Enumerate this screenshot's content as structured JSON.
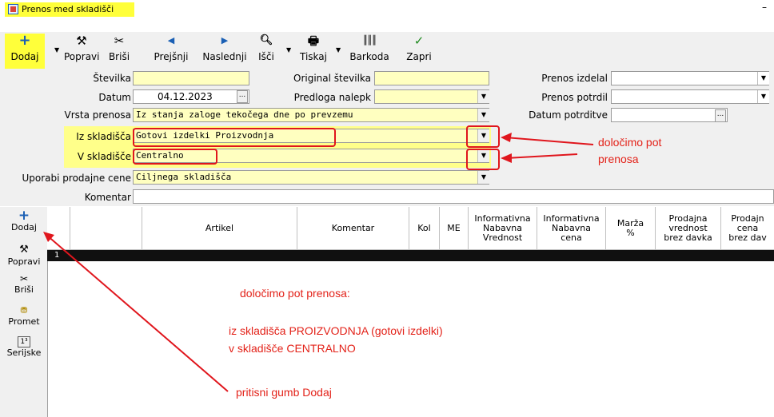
{
  "window": {
    "title": "Prenos med skladišči",
    "minimize": "–"
  },
  "toolbar": {
    "add": "Dodaj",
    "edit": "Popravi",
    "delete": "Briši",
    "previous": "Prejšnji",
    "next": "Naslednji",
    "search": "Išči",
    "print": "Tiskaj",
    "barcode": "Barkoda",
    "close": "Zapri"
  },
  "form": {
    "stevilka_label": "Številka",
    "datum_label": "Datum",
    "datum_value": "04.12.2023",
    "vrsta_label": "Vrsta prenosa",
    "vrsta_value": "Iz stanja zaloge tekočega dne po prevzemu",
    "original_label": "Original številka",
    "predloga_label": "Predloga nalepk",
    "iz_label": "Iz skladišča",
    "iz_value": "Gotovi izdelki      Proizvodnja",
    "v_label": "V skladišče",
    "v_value": "Centralno",
    "uporabi_label": "Uporabi prodajne cene",
    "uporabi_value": "Ciljnega skladišča",
    "komentar_label": "Komentar",
    "izdelal_label": "Prenos izdelal",
    "potrdil_label": "Prenos potrdil",
    "datum_potrditve_label": "Datum potrditve"
  },
  "grid": {
    "sidebar": {
      "add": "Dodaj",
      "edit": "Popravi",
      "delete": "Briši",
      "promet": "Promet",
      "serijske": "Serijske"
    },
    "columns": {
      "artikel": "Artikel",
      "komentar": "Komentar",
      "kol": "Kol",
      "me": "ME",
      "inf_vrednost": [
        "Informativna",
        "Nabavna",
        "Vrednost"
      ],
      "inf_cena": [
        "Informativna",
        "Nabavna",
        "cena"
      ],
      "marza": [
        "Marža",
        "%"
      ],
      "prod_vrednost": [
        "Prodajna",
        "vrednost",
        "brez davka"
      ],
      "prod_cena": [
        "Prodajn",
        "cena",
        "brez dav"
      ]
    },
    "row_number": "1"
  },
  "annotations": {
    "top_line1": "določimo pot",
    "top_line2": "prenosa",
    "center1": "določimo pot prenosa:",
    "center2": "iz skladišča PROIZVODNJA (gotovi izdelki)",
    "center3": "v skladišče CENTRALNO",
    "bottom": "pritisni gumb Dodaj"
  },
  "colors": {
    "highlight": "#ffff3a",
    "field": "#ffffc0",
    "annotation": "#e32219"
  },
  "icons": [
    "app-icon",
    "plus-icon",
    "hammer-icon",
    "scissors-icon",
    "arrow-left-icon",
    "arrow-right-icon",
    "magnifier-icon",
    "printer-icon",
    "barcode-icon",
    "checkmark-icon",
    "dropdown-icon",
    "ellipsis-icon",
    "traffic-icon",
    "serial-icon"
  ]
}
